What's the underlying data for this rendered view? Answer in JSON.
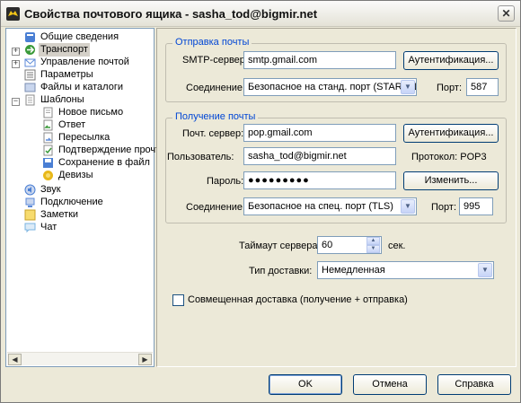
{
  "window": {
    "title": "Свойства почтового ящика - sasha_tod@bigmir.net",
    "close_glyph": "✕"
  },
  "tree": {
    "items": [
      {
        "label": "Общие сведения",
        "icon": "general-info-icon",
        "color": "#4a7fd4"
      },
      {
        "label": "Транспорт",
        "icon": "transport-icon",
        "color": "#3a9a3a",
        "selected": true
      },
      {
        "label": "Управление почтой",
        "icon": "mail-management-icon",
        "color": "#5c8ad8"
      },
      {
        "label": "Параметры",
        "icon": "parameters-icon",
        "color": "#777777"
      },
      {
        "label": "Файлы и каталоги",
        "icon": "files-icon",
        "color": "#7a8db0"
      },
      {
        "label": "Шаблоны",
        "icon": "templates-icon",
        "color": "#8a8a8a"
      },
      {
        "label": "Новое письмо",
        "icon": "new-letter-icon",
        "color": "#8a8a8a"
      },
      {
        "label": "Ответ",
        "icon": "reply-icon",
        "color": "#3a9a3a"
      },
      {
        "label": "Пересылка",
        "icon": "forward-icon",
        "color": "#5c8ad8"
      },
      {
        "label": "Подтверждение прочт",
        "icon": "read-receipt-icon",
        "color": "#3a9a3a"
      },
      {
        "label": "Сохранение в файл",
        "icon": "save-to-file-icon",
        "color": "#4a7fd4"
      },
      {
        "label": "Девизы",
        "icon": "mottos-icon",
        "color": "#e8b81a"
      },
      {
        "label": "Звук",
        "icon": "sound-icon",
        "color": "#4a7fd4"
      },
      {
        "label": "Подключение",
        "icon": "connection-icon",
        "color": "#5c8ad8"
      },
      {
        "label": "Заметки",
        "icon": "notes-icon",
        "color": "#f1c232"
      },
      {
        "label": "Чат",
        "icon": "chat-icon",
        "color": "#7ab3e0"
      }
    ],
    "scroll_left": "◀",
    "scroll_right": "▶"
  },
  "sending": {
    "title": "Отправка почты",
    "smtp_label": "SMTP-сервер:",
    "smtp_value": "smtp.gmail.com",
    "auth_button": "Аутентификация...",
    "connection_label": "Соединение:",
    "connection_value": "Безопасное на станд. порт (STARTTLS)",
    "port_label": "Порт:",
    "port_value": "587"
  },
  "receiving": {
    "title": "Получение почты",
    "server_label": "Почт. сервер:",
    "server_value": "pop.gmail.com",
    "auth_button": "Аутентификация...",
    "user_label": "Пользователь:",
    "user_value": "sasha_tod@bigmir.net",
    "protocol_text": "Протокол:  POP3",
    "password_label": "Пароль:",
    "password_value": "●●●●●●●●●",
    "change_button": "Изменить...",
    "connection_label": "Соединение:",
    "connection_value": "Безопасное на спец. порт (TLS)",
    "port_label": "Порт:",
    "port_value": "995"
  },
  "timeout": {
    "label": "Таймаут сервера:",
    "value": "60",
    "unit": "сек."
  },
  "delivery": {
    "label": "Тип доставки:",
    "value": "Немедленная"
  },
  "combined": {
    "label": "Совмещенная доставка (получение + отправка)",
    "checked": false
  },
  "buttons": {
    "ok": "OK",
    "cancel": "Отмена",
    "help": "Справка"
  },
  "glyphs": {
    "dropdown": "▼",
    "spin_up": "▲",
    "spin_down": "▼",
    "plus": "+",
    "minus": "−"
  }
}
